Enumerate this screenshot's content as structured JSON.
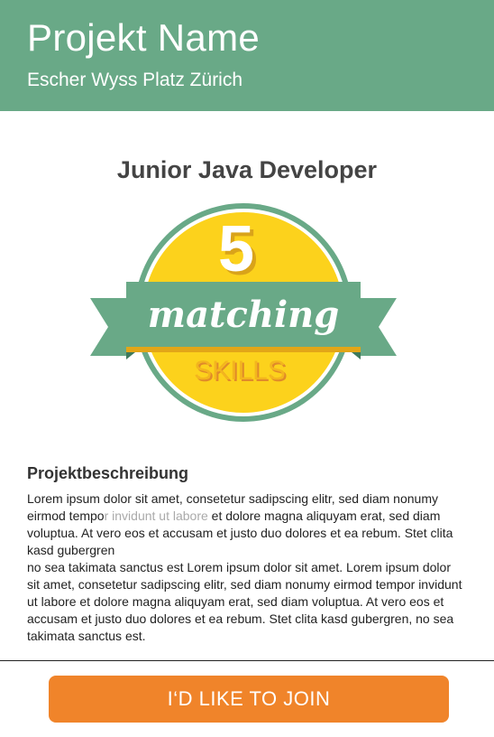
{
  "header": {
    "title": "Projekt Name",
    "location": "Escher Wyss Platz Zürich"
  },
  "job": {
    "title": "Junior Java Developer"
  },
  "badge": {
    "count": "5",
    "word": "matching",
    "label": "SKILLS"
  },
  "description": {
    "heading": "Projektbeschreibung",
    "text_part1": "Lorem ipsum dolor sit amet, consetetur sadipscing elitr, sed diam nonumy eirmod tempo",
    "text_faded": "r invidunt ut labore",
    "text_part2": " et dolore magna aliquyam erat, sed diam voluptua. At vero eos et accusam et justo duo dolores et ea rebum. Stet clita kasd gubergren\nno sea takimata sanctus est Lorem ipsum dolor sit amet. Lorem ipsum dolor sit amet, consetetur sadipscing elitr, sed diam nonumy eirmod tempor invidunt ut labore et dolore magna aliquyam erat, sed diam voluptua. At vero eos et accusam et justo duo dolores et ea rebum. Stet clita kasd gubergren, no sea takimata sanctus est."
  },
  "cta": {
    "label": "I‘D LIKE TO JOIN"
  },
  "colors": {
    "brand_green": "#69a987",
    "badge_yellow": "#fcd21c",
    "cta_orange": "#f0842a"
  }
}
